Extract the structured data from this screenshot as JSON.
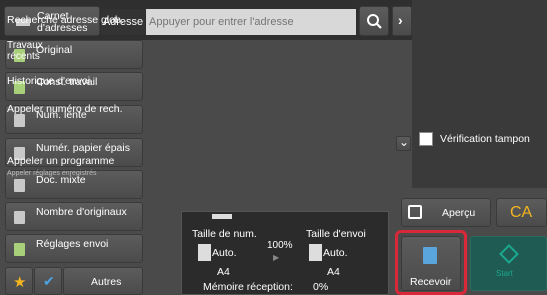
{
  "topbar": {
    "address_book_label": "Carnet\nd'adresses",
    "address_label": "Adresse",
    "address_placeholder": "Appuyer pour entrer l'adresse"
  },
  "sidebar": {
    "items": [
      {
        "label": "Original"
      },
      {
        "label": "Const. travail"
      },
      {
        "label": "Num. lente"
      },
      {
        "label": "Numér. papier épais"
      },
      {
        "label": "Doc. mixte"
      },
      {
        "label": "Nombre d'originaux"
      },
      {
        "label": "Réglages envoi"
      }
    ],
    "others_label": "Autres"
  },
  "right_panel": {
    "global_search": "Recherche adresse glob.",
    "recent_jobs": "Travaux\nrécents",
    "send_history": "Historique d'envoi",
    "search_number": "Appeler numéro de rech.",
    "stamp_check": "Vérification tampon",
    "call_program": "Appeler un programme",
    "saved_settings": "Appeler réglages enregistrés"
  },
  "status": {
    "scan_size_label": "Taille de num.",
    "send_size_label": "Taille d'envoi",
    "scan_mode": "Auto.",
    "send_mode": "Auto.",
    "ratio": "100%",
    "scan_paper": "A4",
    "send_paper": "A4",
    "memory_label": "Mémoire réception:",
    "memory_value": "0%"
  },
  "actions": {
    "preview_label": "Aperçu",
    "ca_label": "CA",
    "receive_label": "Recevoir",
    "start_label": "Start"
  },
  "colors": {
    "accent": "#d8283a",
    "ca": "#f2b51f",
    "start": "#1aa88f"
  }
}
